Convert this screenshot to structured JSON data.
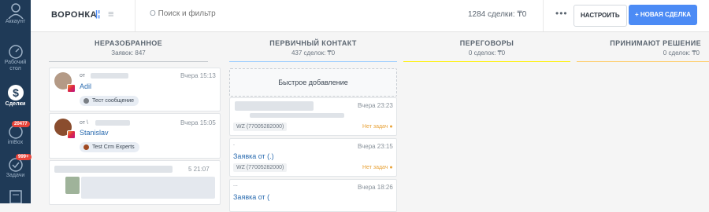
{
  "sidebar": {
    "items": [
      {
        "label": "Аккаунт"
      },
      {
        "label": "Рабочий стол"
      },
      {
        "label": "Сделки"
      },
      {
        "label": "imBox",
        "badge": "20477"
      },
      {
        "label": "Задачи",
        "badge": "999+"
      }
    ]
  },
  "header": {
    "title": "ВОРОНКА",
    "search_placeholder": "Поиск и фильтр",
    "deals_summary": "1284 сделки: ₸0",
    "more": "•••",
    "configure_label": "НАСТРОИТЬ",
    "new_deal_label": "+ НОВАЯ СДЕЛКА"
  },
  "columns": [
    {
      "name": "НЕРАЗОБРАННОЕ",
      "sub": "Заявок: 847",
      "color": "#c2c7cc"
    },
    {
      "name": "ПЕРВИЧНЫЙ КОНТАКТ",
      "sub": "437 сделок: ₸0",
      "color": "#99ccff"
    },
    {
      "name": "ПЕРЕГОВОРЫ",
      "sub": "0 сделок: ₸0",
      "color": "#fff000"
    },
    {
      "name": "ПРИНИМАЮТ РЕШЕНИЕ",
      "sub": "0 сделок: ₸0",
      "color": "#ffcc66"
    }
  ],
  "unsorted_cards": [
    {
      "from": "от",
      "time": "Вчера 15:13",
      "name": "Adil",
      "chip": "Тест сообщение"
    },
    {
      "from": "от \\",
      "time": "Вчера 15:05",
      "name": "Stanislav",
      "chip": "Test Crm Experts"
    },
    {
      "time": "5 21:07"
    }
  ],
  "quick_add": "Быстрое добавление",
  "contact_cards": [
    {
      "time": "Вчера 23:23",
      "tag": "WZ (77005282000)",
      "no_task": "Нет задач"
    },
    {
      "time": "Вчера 23:15",
      "title": "Заявка от (.)",
      "tag": "WZ (77005282000)",
      "no_task": "Нет задач",
      "dot": "."
    },
    {
      "time": "Вчера 18:26",
      "title": "Заявка от (",
      "dot": "..."
    }
  ],
  "colors": {
    "sidebar": "#1f3a57",
    "accent": "#4c8bf5",
    "badge": "#e8443a",
    "link": "#2b6cb0"
  }
}
